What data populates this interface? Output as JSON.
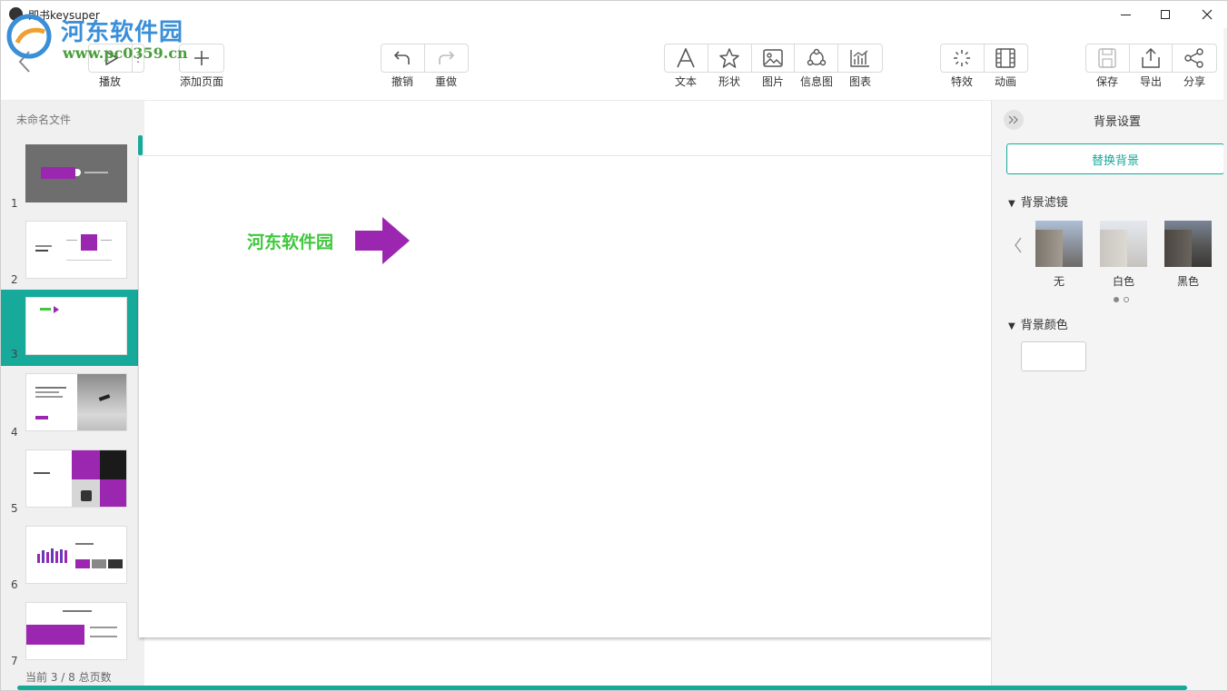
{
  "window": {
    "title": "即书keysuper",
    "watermark_cn": "河东软件园",
    "watermark_url": "www.pc0359.cn"
  },
  "toolbar": {
    "play_label": "播放",
    "add_page_label": "添加页面",
    "undo_label": "撤销",
    "redo_label": "重做",
    "text_label": "文本",
    "shape_label": "形状",
    "image_label": "图片",
    "infographic_label": "信息图",
    "chart_label": "图表",
    "effects_label": "特效",
    "animation_label": "动画",
    "save_label": "保存",
    "export_label": "导出",
    "share_label": "分享"
  },
  "slides_panel": {
    "doc_name": "未命名文件",
    "thumbnails": [
      {
        "number": "1",
        "active": false
      },
      {
        "number": "2",
        "active": false
      },
      {
        "number": "3",
        "active": true
      },
      {
        "number": "4",
        "active": false
      },
      {
        "number": "5",
        "active": false
      },
      {
        "number": "6",
        "active": false
      },
      {
        "number": "7",
        "active": false
      }
    ],
    "status": "当前 3 / 8 总页数"
  },
  "slide": {
    "text": "河东软件园",
    "text_color": "#3ec83c",
    "arrow_color": "#9b27b0"
  },
  "right_panel": {
    "title": "背景设置",
    "replace_button": "替换背景",
    "filter_section": "背景滤镜",
    "filters": [
      "无",
      "白色",
      "黑色"
    ],
    "color_section": "背景颜色"
  },
  "colors": {
    "accent": "#17a99a",
    "purple": "#9b27b0"
  }
}
